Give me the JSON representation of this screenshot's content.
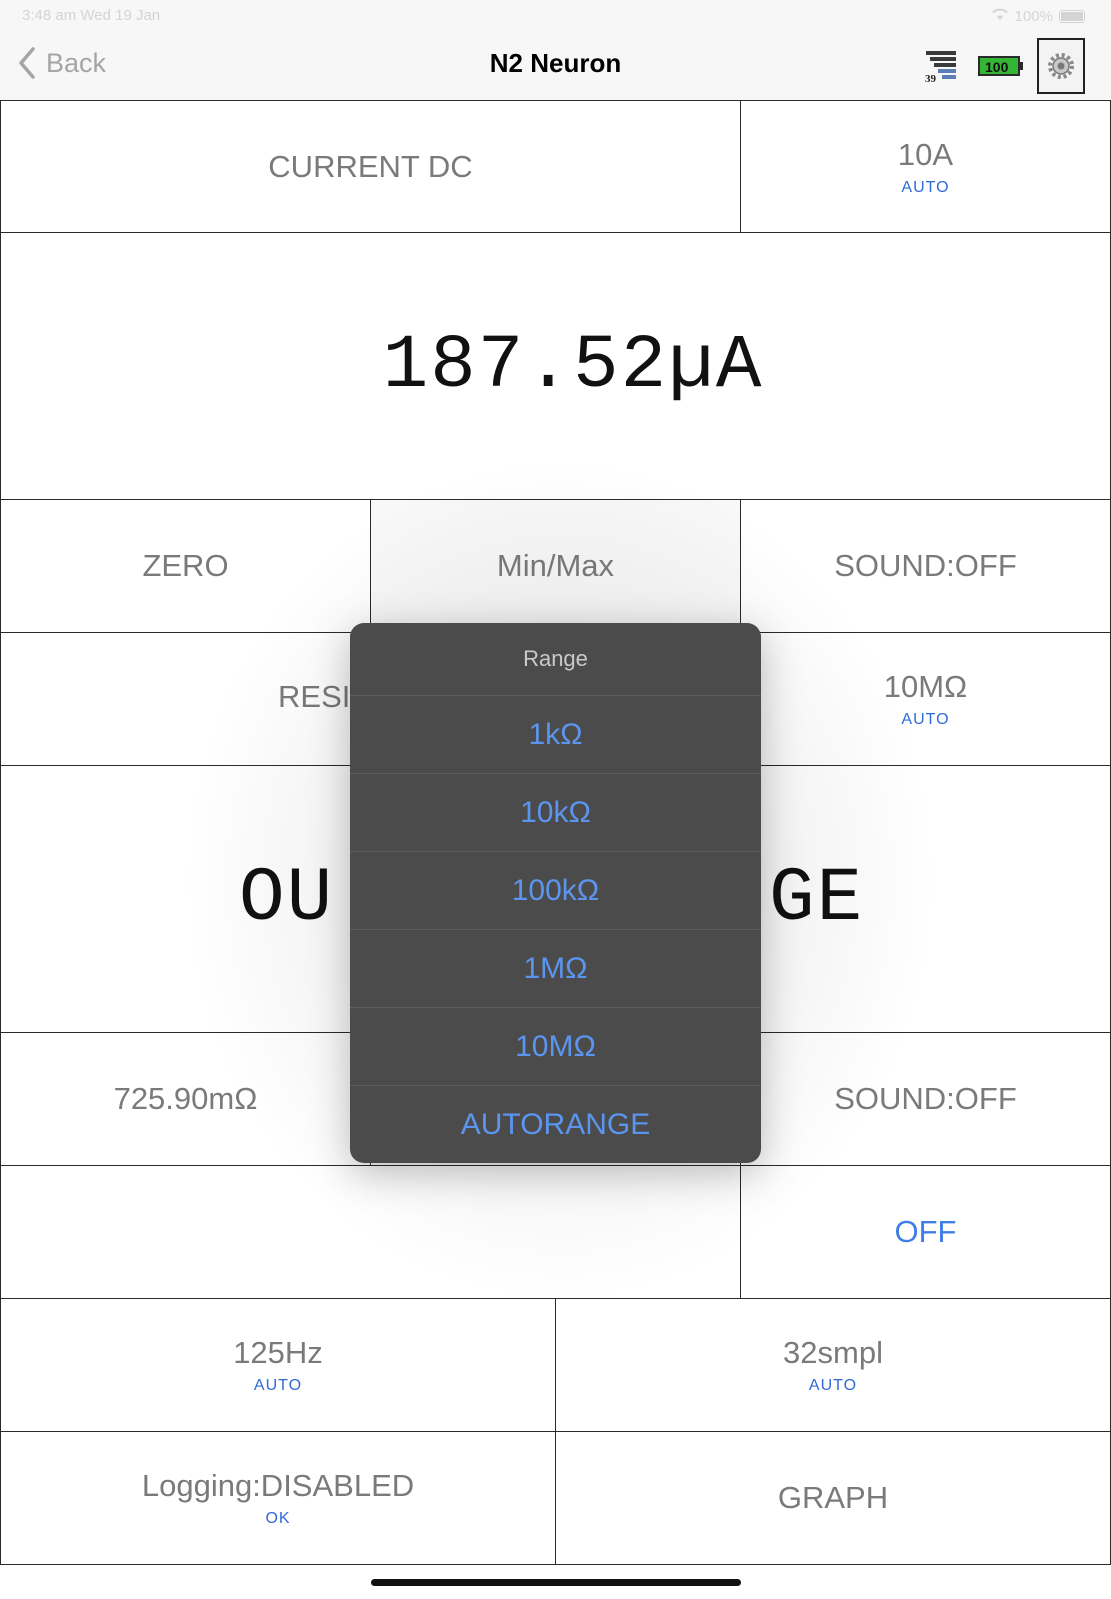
{
  "status_bar": {
    "time_date": "3:48 am  Wed 19 Jan",
    "battery_text": "100%"
  },
  "nav": {
    "back_label": "Back",
    "title": "N2 Neuron",
    "signal_value": "39",
    "battery_value": "100"
  },
  "rows": {
    "mode": {
      "label": "CURRENT DC",
      "range": "10A",
      "range_sub": "AUTO"
    },
    "reading": {
      "value": "187.52µA"
    },
    "controls": {
      "zero": "ZERO",
      "minmax": "Min/Max",
      "sound": "SOUND:OFF"
    },
    "mode2": {
      "label": "RESIS",
      "range": "10MΩ",
      "range_sub": "AUTO"
    },
    "reading2": {
      "left": "OU",
      "right": "GE"
    },
    "controls2": {
      "value": "725.90mΩ",
      "sound": "SOUND:OFF"
    },
    "toggle": {
      "state": "OFF"
    },
    "rate": {
      "value": "125Hz",
      "sub": "AUTO"
    },
    "samples": {
      "value": "32smpl",
      "sub": "AUTO"
    },
    "logging": {
      "value": "Logging:DISABLED",
      "sub": "OK"
    },
    "graph": {
      "label": "GRAPH"
    }
  },
  "popup": {
    "title": "Range",
    "options": [
      "1kΩ",
      "10kΩ",
      "100kΩ",
      "1MΩ",
      "10MΩ",
      "AUTORANGE"
    ]
  },
  "colors": {
    "accent": "#3e7ee6",
    "popup_bg": "#4b4b4b",
    "option_text": "#5b95ef"
  }
}
